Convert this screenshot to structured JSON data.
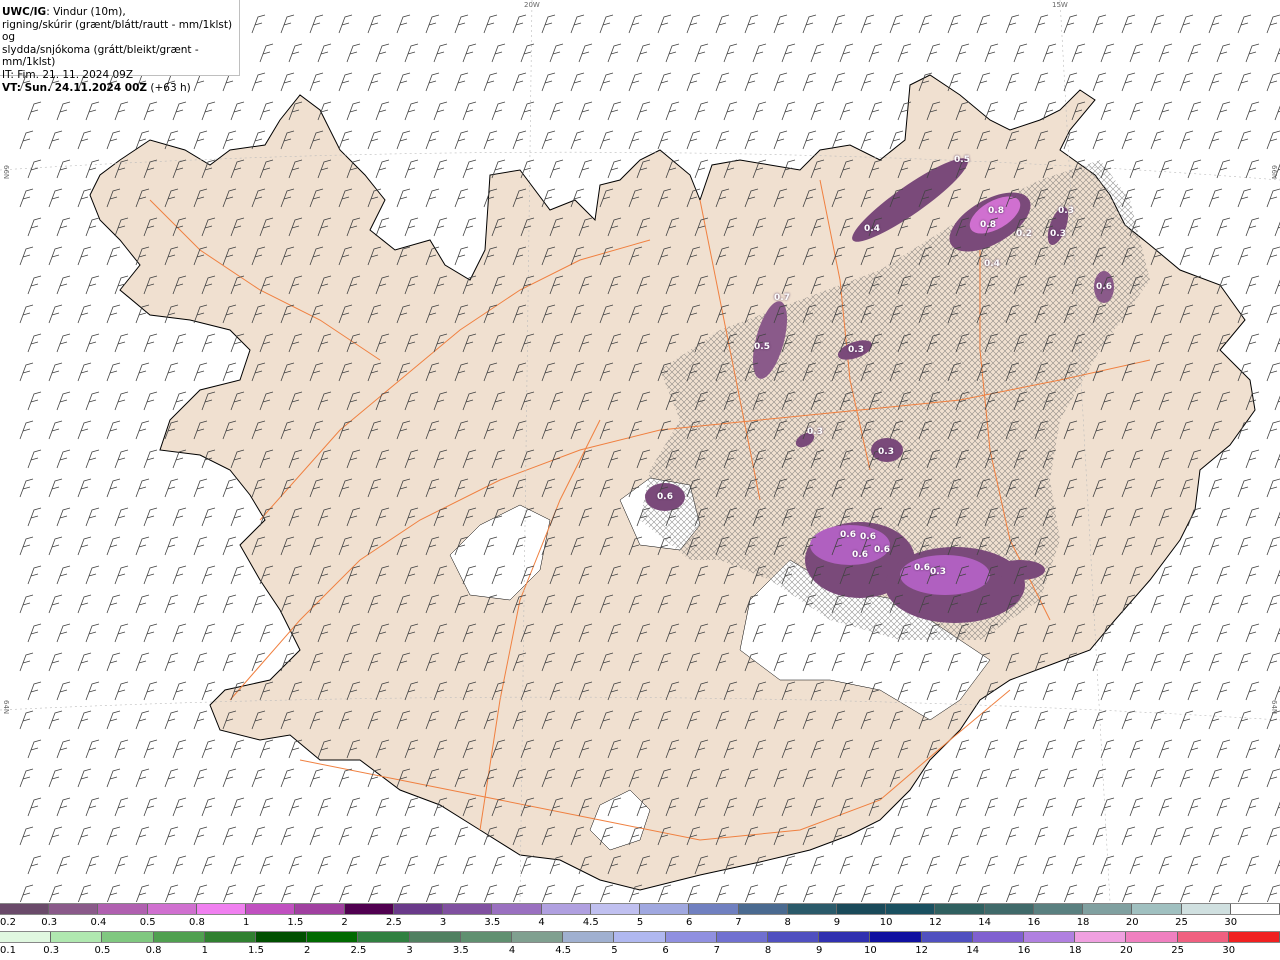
{
  "header": {
    "product": "UWC/IG",
    "line1_rest": ": Vindur (10m),",
    "line2": "rigning/skúrir (grænt/blátt/rautt - mm/1klst) og",
    "line3": "slydda/snjókoma (grátt/bleikt/grænt - mm/1klst)",
    "issue_time": "IT: Fim. 21. 11. 2024 09Z",
    "valid_label": "VT: Sun. 24.11.2024 00Z",
    "valid_offset": "(+63 h)"
  },
  "grid_labels": {
    "lon_20w": "20W",
    "lon_15w": "15W",
    "lat_66n_left": "66N",
    "lat_66n_right": "66N",
    "lat_64n_left": "64N",
    "lat_64n_right": "64N"
  },
  "colors": {
    "land": "#f0e0d0",
    "roads": "#f08040",
    "glacier": "#ffffff",
    "coast": "#000000",
    "wind_barbs": "#444444",
    "precip_low": "#7a4a7a",
    "precip_mid": "#b060c0",
    "precip_high": "#f080f0"
  },
  "precip_labels": [
    "0.5",
    "0.8",
    "0.3",
    "0.4",
    "0.8",
    "0.2",
    "0.3",
    "0.4",
    "0.6",
    "0.7",
    "0.5",
    "0.3",
    "0.3",
    "0.3",
    "0.6",
    "0.6",
    "0.6",
    "0.6",
    "0.6",
    "0.6",
    "0.3"
  ],
  "snow_scale": {
    "labels": [
      "0.2",
      "0.3",
      "0.4",
      "0.5",
      "0.8",
      "1",
      "1.5",
      "2",
      "2.5",
      "3",
      "3.5",
      "4",
      "4.5",
      "5",
      "6",
      "7",
      "8",
      "9",
      "10",
      "12",
      "14",
      "16",
      "18",
      "20",
      "25",
      "30"
    ],
    "colors": [
      "#6a4a6a",
      "#8a5a8a",
      "#b060b0",
      "#d070d0",
      "#f080f0",
      "#c050c0",
      "#a040a0",
      "#500050",
      "#6a3a8a",
      "#8050a0",
      "#9a70c0",
      "#b0a0e0",
      "#c0c0f0",
      "#a0a8e0",
      "#7080c0",
      "#4a6a90",
      "#2a5a6a",
      "#1a4a5a",
      "#1a5060",
      "#306060",
      "#406a6a",
      "#5a8080",
      "#80a0a0",
      "#a0c0c0",
      "#d0e0e0",
      "#ffffff"
    ]
  },
  "rain_scale": {
    "labels": [
      "0.1",
      "0.3",
      "0.5",
      "0.8",
      "1",
      "1.5",
      "2",
      "2.5",
      "3",
      "3.5",
      "4",
      "4.5",
      "5",
      "6",
      "7",
      "8",
      "9",
      "10",
      "12",
      "14",
      "16",
      "18",
      "20",
      "25",
      "30"
    ],
    "colors": [
      "#e0f8e0",
      "#b0e8b0",
      "#80c880",
      "#50a050",
      "#308030",
      "#005000",
      "#006a00",
      "#308040",
      "#508060",
      "#609070",
      "#80a090",
      "#a0b0d0",
      "#b0b8f0",
      "#9090e0",
      "#7070d0",
      "#5050c0",
      "#3030b0",
      "#1010a0",
      "#5050c0",
      "#8060d0",
      "#b080e0",
      "#f0a0e0",
      "#f080c0",
      "#f06080",
      "#f02020"
    ]
  }
}
